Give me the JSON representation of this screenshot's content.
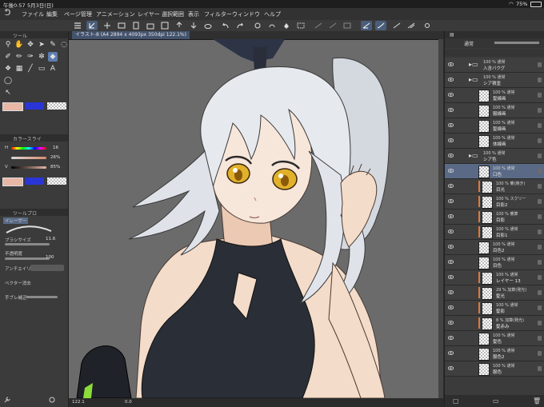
{
  "status": {
    "time": "午後0:57",
    "date": "5月3日(日)",
    "battery": "75%"
  },
  "menu": [
    "ファイル",
    "編集",
    "ページ管理",
    "アニメーション",
    "レイヤー",
    "選択範囲",
    "表示",
    "フィルター",
    "ウィンドウ",
    "ヘルプ"
  ],
  "document": {
    "tab_title": "イラスト-8 (A4 2894 x 4093px 350dpi 122.1%)"
  },
  "left_panel": {
    "tool_header": "ツール",
    "color_header": "カラースライ",
    "slider_h_label": "H",
    "slider_h_value": "16",
    "slider_s_value": "26%",
    "slider_v_label": "V",
    "slider_v_value": "85%",
    "subtool_header": "ツールプロ",
    "brush_name": "イレーザー",
    "brush_size_label": "ブラシサイズ",
    "brush_size_value": "11.6",
    "opacity_label": "不透明度",
    "opacity_value": "100",
    "antialias_label": "アンチエイリ",
    "vector_label": "ベクター消去",
    "stabilize_label": "手ブレ補正",
    "colors": {
      "main": "#e8b7a6",
      "sub": "#2a35d8"
    }
  },
  "canvas_footer": {
    "zoom": "122.1",
    "rotate": "0.0"
  },
  "right_panel": {
    "blend_mode": "通常",
    "layers": [
      {
        "line1": "100 % 通常",
        "line2": "入含バクグ",
        "type": "folder",
        "sel": false
      },
      {
        "line1": "100 % 通常",
        "line2": "シア積塗",
        "type": "folder",
        "sel": false
      },
      {
        "line1": "100 % 通常",
        "line2": "髪線画",
        "type": "layer",
        "sel": false
      },
      {
        "line1": "100 % 通常",
        "line2": "服線画",
        "type": "layer",
        "sel": false
      },
      {
        "line1": "100 % 通常",
        "line2": "髪線画",
        "type": "layer",
        "sel": false
      },
      {
        "line1": "100 % 通常",
        "line2": "体線画",
        "type": "layer",
        "sel": false
      },
      {
        "line1": "100 % 通常",
        "line2": "シア色",
        "type": "folder",
        "sel": false
      },
      {
        "line1": "100 % 通常",
        "line2": "口色",
        "type": "layer",
        "sel": true
      },
      {
        "line1": "100 % 乗(焼き)",
        "line2": "目光",
        "type": "clip",
        "sel": false
      },
      {
        "line1": "100 % スクリー",
        "line2": "目影2",
        "type": "clip",
        "sel": false
      },
      {
        "line1": "100 % 乗算",
        "line2": "目影",
        "type": "clip",
        "sel": false
      },
      {
        "line1": "100 % 通常",
        "line2": "目影1",
        "type": "clip",
        "sel": false
      },
      {
        "line1": "100 % 通常",
        "line2": "目色2",
        "type": "layer",
        "sel": false
      },
      {
        "line1": "100 % 通常",
        "line2": "目色",
        "type": "layer",
        "sel": false
      },
      {
        "line1": "100 % 通常",
        "line2": "レイヤー 13",
        "type": "clip",
        "sel": false
      },
      {
        "line1": "29 % 加算(発光)",
        "line2": "髪光",
        "type": "clip",
        "sel": false
      },
      {
        "line1": "100 % 通常",
        "line2": "髪影",
        "type": "clip",
        "sel": false
      },
      {
        "line1": "8 % 加算(発光)",
        "line2": "髪赤み",
        "type": "clip",
        "sel": false
      },
      {
        "line1": "100 % 通常",
        "line2": "髪色",
        "type": "layer",
        "sel": false
      },
      {
        "line1": "100 % 通常",
        "line2": "服色2",
        "type": "layer",
        "sel": false
      },
      {
        "line1": "100 % 通常",
        "line2": "服色",
        "type": "layer",
        "sel": false
      }
    ]
  }
}
